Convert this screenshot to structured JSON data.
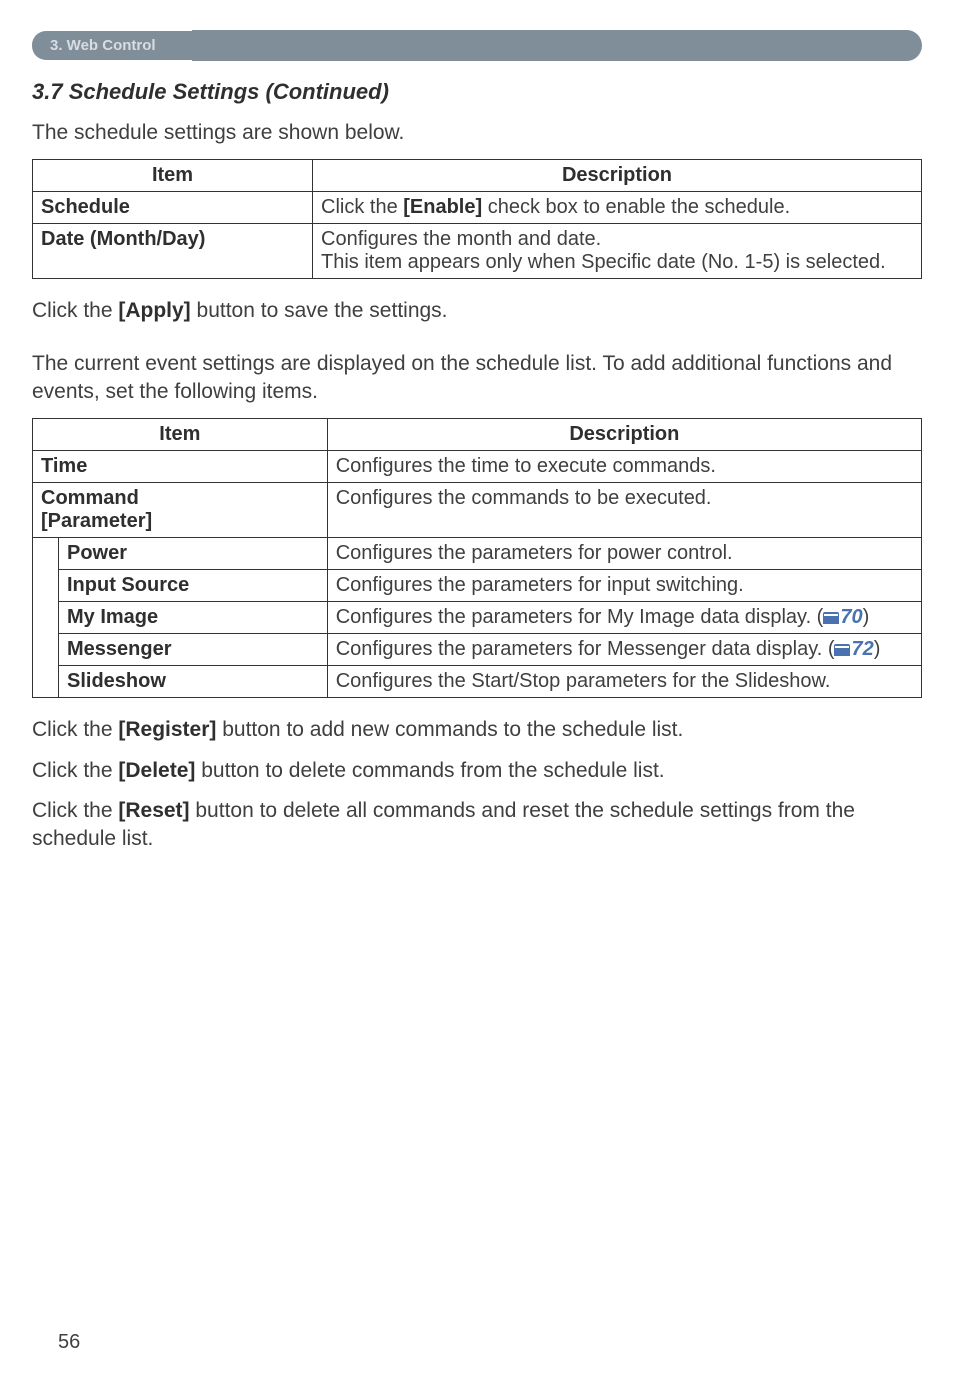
{
  "breadcrumb": "3. Web Control",
  "section_title": "3.7 Schedule Settings (Continued)",
  "intro1": "The schedule settings are shown below.",
  "table1": {
    "headers": {
      "item": "Item",
      "description": "Description"
    },
    "rows": [
      {
        "label": "Schedule",
        "desc_pre": "Click the ",
        "desc_bold": "[Enable]",
        "desc_post": " check box to enable the schedule."
      },
      {
        "label": "Date (Month/Day)",
        "desc_lines": [
          "Configures the month and date.",
          "This item appears only when Specific date (No. 1-5) is selected."
        ]
      }
    ]
  },
  "apply_pre": "Click the ",
  "apply_bold": "[Apply]",
  "apply_post": " button to save the settings.",
  "intro2": "The current event settings are displayed on the schedule list. To add additional functions and events, set the following items.",
  "table2": {
    "headers": {
      "item": "Item",
      "description": "Description"
    },
    "rows": {
      "time": {
        "label": "Time",
        "desc": "Configures the time to execute commands."
      },
      "command": {
        "label_line1": "Command",
        "label_line2": "[Parameter]",
        "desc": "Configures the commands to be executed."
      },
      "power": {
        "label": "Power",
        "desc": "Configures the parameters for power control."
      },
      "input": {
        "label": "Input Source",
        "desc": "Configures the parameters for input switching."
      },
      "myimage": {
        "label": "My Image",
        "desc_pre": "Configures the parameters for My Image data display. (",
        "ref": "70",
        "desc_post": ")"
      },
      "messenger": {
        "label": "Messenger",
        "desc_pre": "Configures the parameters for Messenger data display. (",
        "ref": "72",
        "desc_post": ")"
      },
      "slideshow": {
        "label": "Slideshow",
        "desc": "Configures the Start/Stop parameters for the Slideshow."
      }
    }
  },
  "register_pre": "Click the ",
  "register_bold": "[Register]",
  "register_post": " button to add new commands to the schedule list.",
  "delete_pre": "Click the ",
  "delete_bold": "[Delete]",
  "delete_post": " button to delete commands from the schedule list.",
  "reset_pre": "Click the ",
  "reset_bold": "[Reset]",
  "reset_post": " button to delete all commands and reset the schedule settings from the schedule list.",
  "page_number": "56"
}
